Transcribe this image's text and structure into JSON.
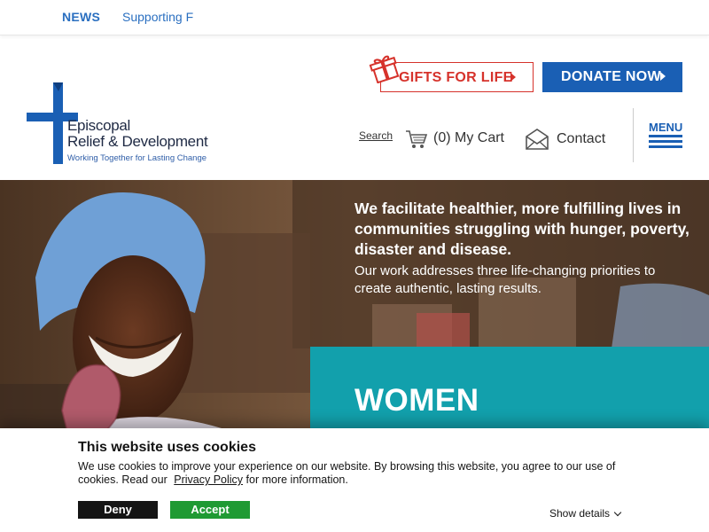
{
  "ticker": {
    "news_label": "NEWS",
    "item_text": "Supporting Farmers"
  },
  "logo": {
    "line1": "Episcopal",
    "line2": "Relief & Development",
    "tagline": "Working Together for Lasting Change"
  },
  "header": {
    "gifts_label": "GIFTS FOR LIFE",
    "donate_label": "DONATE NOW",
    "search_label": "Search",
    "cart_label": "(0) My Cart",
    "contact_label": "Contact",
    "menu_label": "MENU"
  },
  "hero": {
    "title": "We facilitate healthier, more fulfilling lives in communities struggling with hunger, poverty, disaster and disease.",
    "subtitle": "Our work addresses three life-changing priorities to create authentic, lasting results.",
    "panel_label": "WOMEN"
  },
  "cookie": {
    "title": "This website uses cookies",
    "body": "We use cookies to improve your experience on our website. By browsing this website, you agree to our use of cookies. Read our",
    "policy_link": "Privacy Policy",
    "body_end": "for more information.",
    "deny_label": "Deny",
    "accept_label": "Accept",
    "show_details_label": "Show details"
  },
  "colors": {
    "brand_blue": "#1a5fb4",
    "gift_red": "#d6322b",
    "teal": "#12a0ac",
    "accept_green": "#1f9a33"
  }
}
